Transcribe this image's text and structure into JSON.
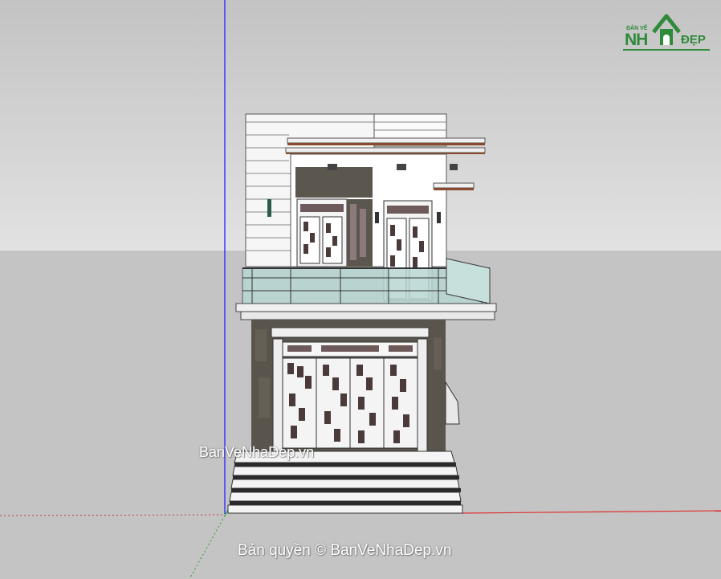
{
  "scene": {
    "sky_color": "#d0d0d0",
    "ground_color": "#c4c4c4",
    "axis_blue": "#3a3aff",
    "axis_red": "#e03030",
    "axis_green": "#2aa02a"
  },
  "watermarks": {
    "middle": "BanVeNhaDep.vn",
    "bottom": "Bản quyền © BanVeNhaDep.vn"
  },
  "logo": {
    "top_text": "BẢN VẼ",
    "main_text": "NH",
    "tail_text": "ĐẸP",
    "color": "#2f8a3a",
    "icon": "house-logo-icon"
  },
  "model": {
    "description_icon": "two-story-house-model",
    "wall_color": "#f4f4f4",
    "stone_color": "#5a554c",
    "roof_trim_color": "#8a4a30",
    "glass_color": "#b8d6d3"
  }
}
